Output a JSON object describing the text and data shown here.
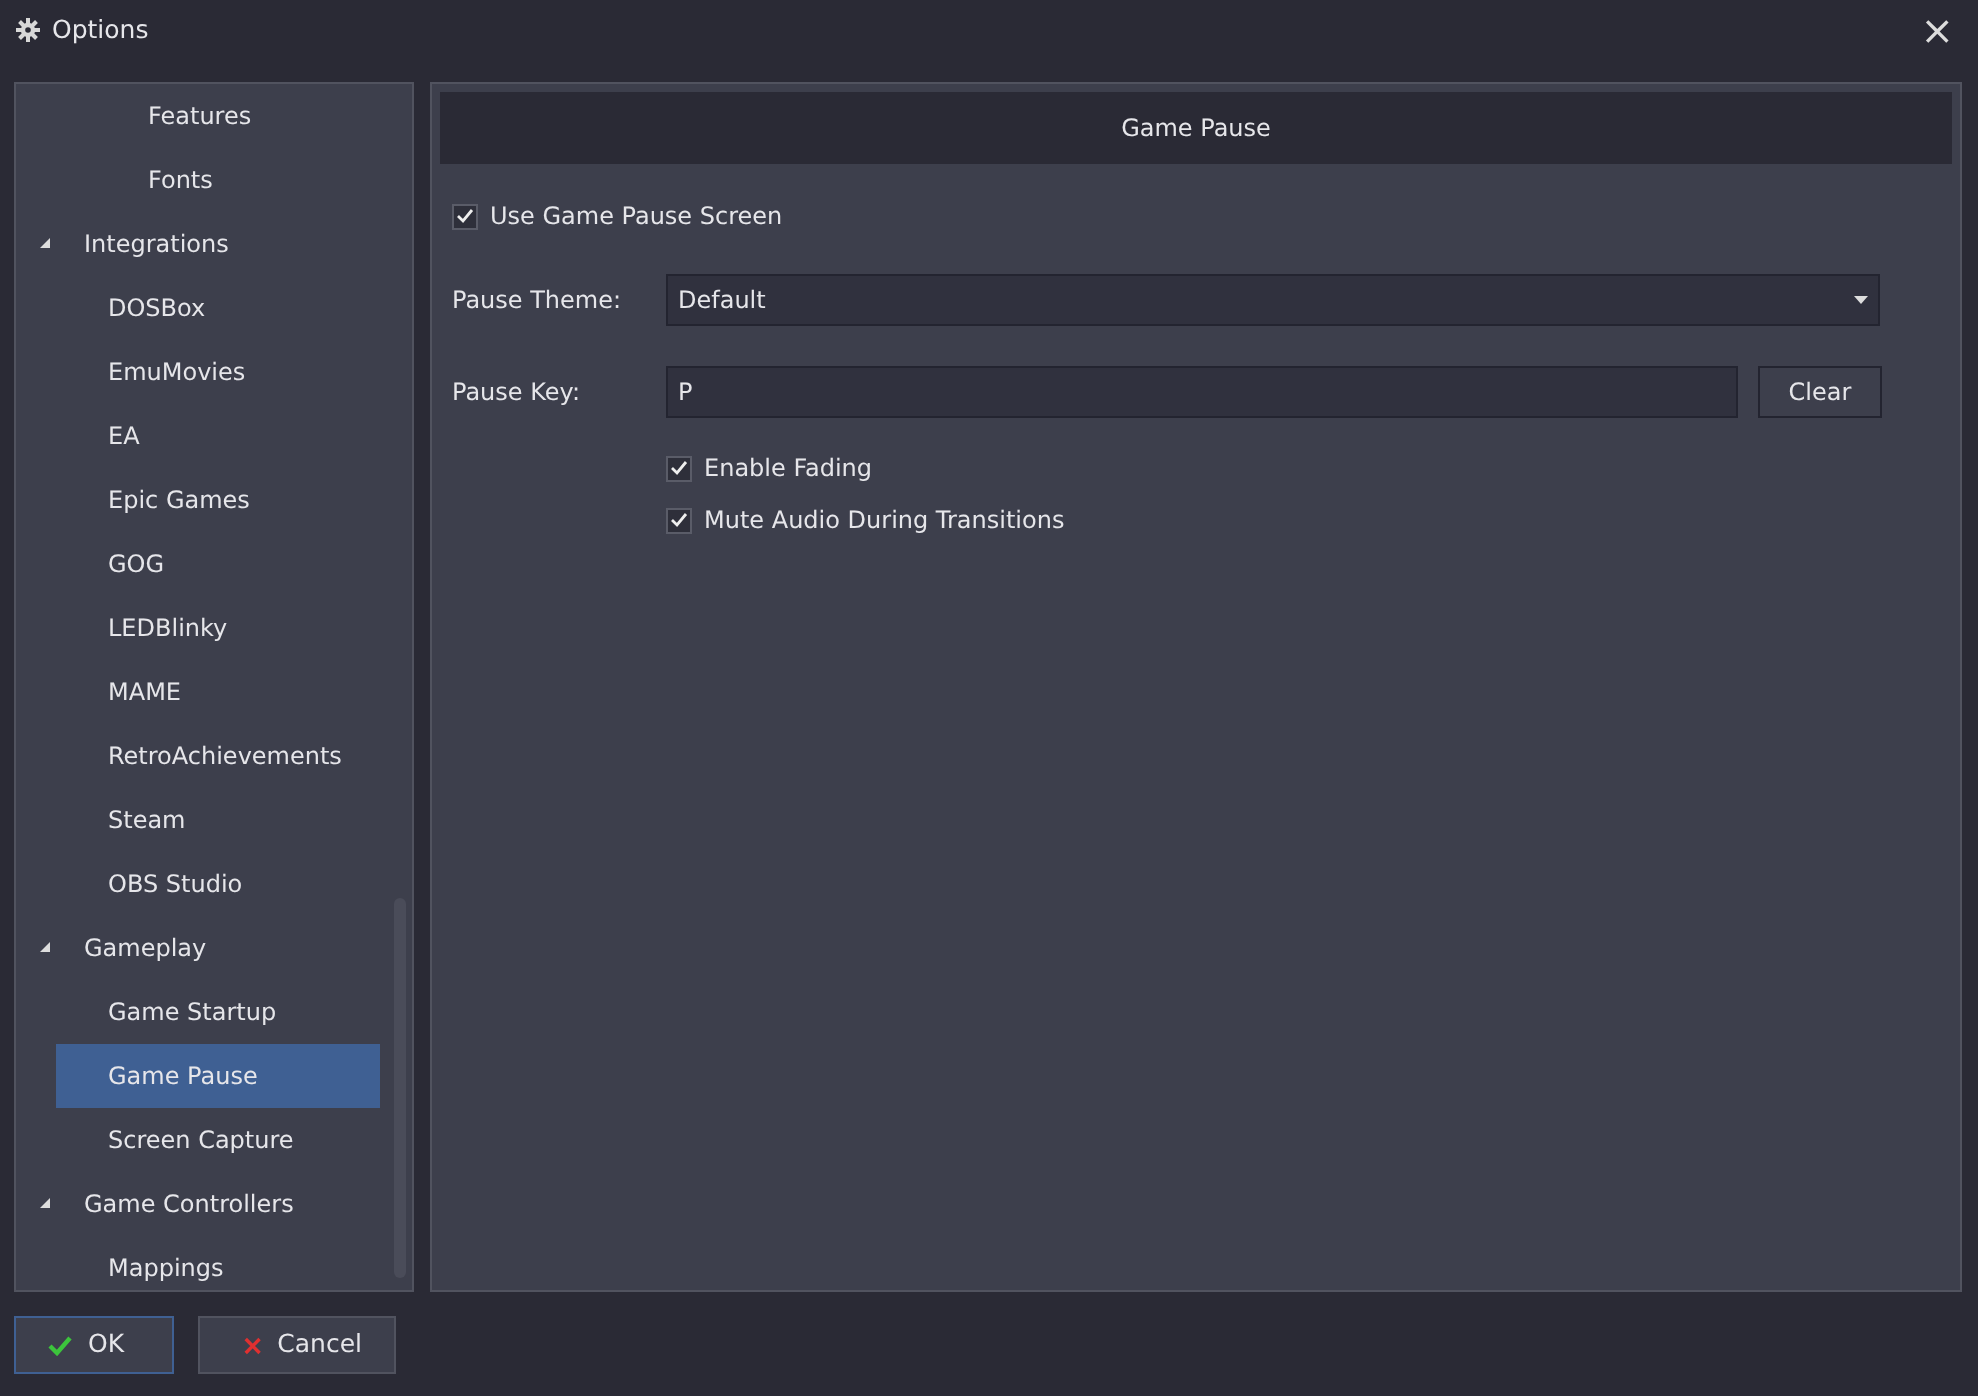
{
  "window": {
    "title": "Options",
    "close": "×"
  },
  "tree": [
    {
      "children": [
        {
          "children": [
            {
              "label": "Features",
              "selected": false
            },
            {
              "label": "Fonts",
              "selected": false
            }
          ]
        }
      ]
    },
    {
      "label": "Integrations",
      "expanded": true,
      "selected": false,
      "children": [
        {
          "label": "DOSBox",
          "selected": false
        },
        {
          "label": "EmuMovies",
          "selected": false
        },
        {
          "label": "EA",
          "selected": false
        },
        {
          "label": "Epic Games",
          "selected": false
        },
        {
          "label": "GOG",
          "selected": false
        },
        {
          "label": "LEDBlinky",
          "selected": false
        },
        {
          "label": "MAME",
          "selected": false
        },
        {
          "label": "RetroAchievements",
          "selected": false
        },
        {
          "label": "Steam",
          "selected": false
        },
        {
          "label": "OBS Studio",
          "selected": false
        }
      ]
    },
    {
      "label": "Gameplay",
      "expanded": true,
      "selected": false,
      "children": [
        {
          "label": "Game Startup",
          "selected": false
        },
        {
          "label": "Game Pause",
          "selected": true
        },
        {
          "label": "Screen Capture",
          "selected": false
        }
      ]
    },
    {
      "label": "Game Controllers",
      "expanded": true,
      "selected": false,
      "children": [
        {
          "label": "Mappings",
          "selected": false
        }
      ]
    }
  ],
  "panel": {
    "title": "Game Pause",
    "use_screen": {
      "label": "Use Game Pause Screen",
      "checked": true
    },
    "theme": {
      "label": "Pause Theme:",
      "value": "Default"
    },
    "key": {
      "label": "Pause Key:",
      "value": "P",
      "button": "Clear"
    },
    "options": [
      {
        "label": "Enable Fading",
        "checked": true
      },
      {
        "label": "Mute Audio During Transitions",
        "checked": true
      }
    ]
  },
  "buttons": [
    {
      "kind": "ok",
      "label": "OK"
    },
    {
      "kind": "cancel",
      "label": "Cancel"
    }
  ]
}
